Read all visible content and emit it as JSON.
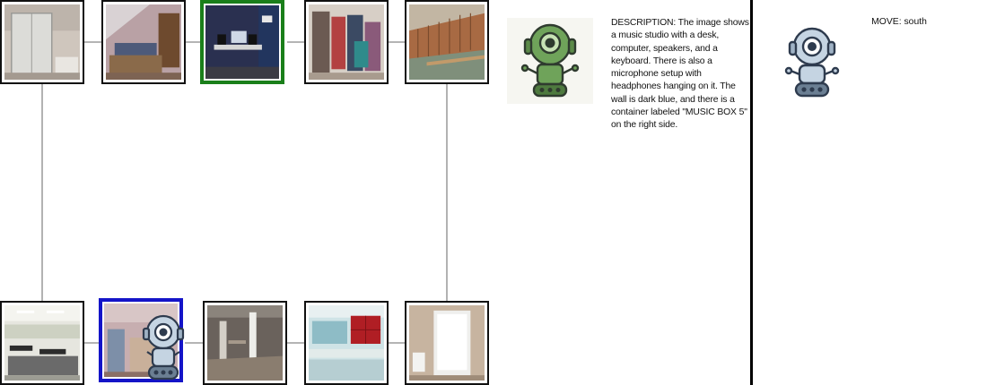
{
  "map": {
    "rooms": [
      {
        "id": "r1",
        "scene": "bathroom-shower",
        "state": "normal"
      },
      {
        "id": "r2",
        "scene": "attic-bedroom",
        "state": "normal"
      },
      {
        "id": "r3",
        "scene": "music-studio",
        "state": "visited"
      },
      {
        "id": "r4",
        "scene": "closet",
        "state": "normal"
      },
      {
        "id": "r5",
        "scene": "locker-room",
        "state": "normal"
      },
      {
        "id": "r6",
        "scene": "cafeteria",
        "state": "normal"
      },
      {
        "id": "r7",
        "scene": "bedroom-pastel",
        "state": "current"
      },
      {
        "id": "r8",
        "scene": "basement",
        "state": "normal"
      },
      {
        "id": "r9",
        "scene": "modern-room-red-lockers",
        "state": "normal"
      },
      {
        "id": "r10",
        "scene": "bathroom-white",
        "state": "normal"
      }
    ],
    "colors": {
      "visited_border": "#1a7f1a",
      "current_border": "#1414c8",
      "edge": "#888888"
    }
  },
  "observation": {
    "robot_icon": "green-robot-icon",
    "description": "DESCRIPTION: The image shows a music studio with a desk, computer, speakers, and a keyboard. There is also a microphone setup with headphones hanging on it. The wall is dark blue, and there is a container labeled \"MUSIC BOX 5\" on the right side."
  },
  "action": {
    "robot_icon": "blue-robot-icon",
    "move_text": "MOVE: south"
  }
}
